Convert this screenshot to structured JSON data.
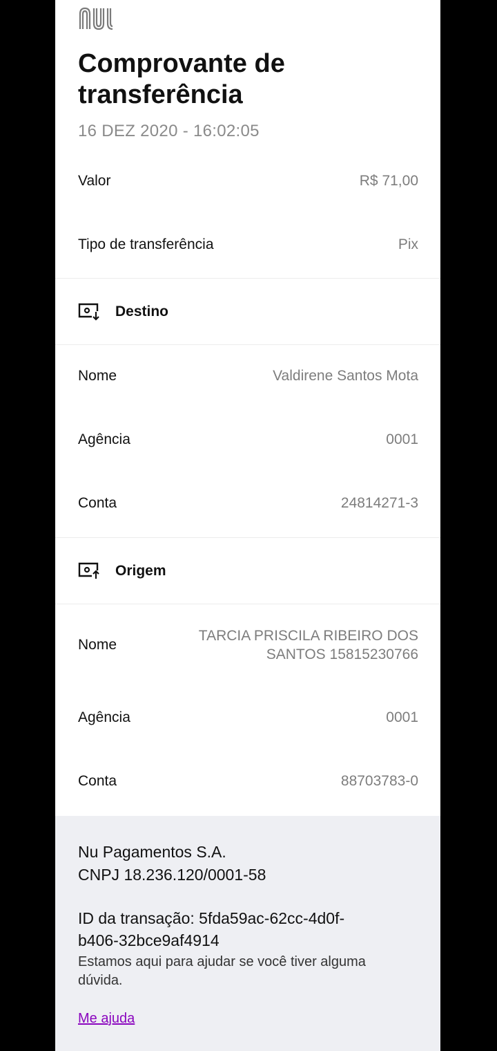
{
  "header": {
    "logo_icon": "nubank-logo",
    "title": "Comprovante de transferência",
    "datetime": "16 DEZ 2020 - 16:02:05"
  },
  "summary": [
    {
      "label": "Valor",
      "value": "R$ 71,00"
    },
    {
      "label": "Tipo de transferência",
      "value": "Pix"
    }
  ],
  "destino": {
    "title": "Destino",
    "icon": "receive-money-icon",
    "fields": [
      {
        "label": "Nome",
        "value": "Valdirene Santos Mota"
      },
      {
        "label": "Agência",
        "value": "0001"
      },
      {
        "label": "Conta",
        "value": "24814271-3"
      }
    ]
  },
  "origem": {
    "title": "Origem",
    "icon": "send-money-icon",
    "fields": [
      {
        "label": "Nome",
        "value_line1": "TARCIA PRISCILA RIBEIRO DOS",
        "value_line2": "SANTOS 15815230766"
      },
      {
        "label": "Agência",
        "value": "0001"
      },
      {
        "label": "Conta",
        "value": "88703783-0"
      }
    ]
  },
  "footer": {
    "company_line1": "Nu Pagamentos S.A.",
    "company_line2": "CNPJ 18.236.120/0001-58",
    "txid_line1": "ID da transação: 5fda59ac-62cc-4d0f-",
    "txid_line2": "b406-32bce9af4914",
    "help_text": "Estamos aqui para ajudar se você tiver alguma dúvida.",
    "help_link": "Me ajuda"
  },
  "colors": {
    "accent": "#8a05be",
    "background": "#000000",
    "footer_bg": "#eeeff3"
  }
}
